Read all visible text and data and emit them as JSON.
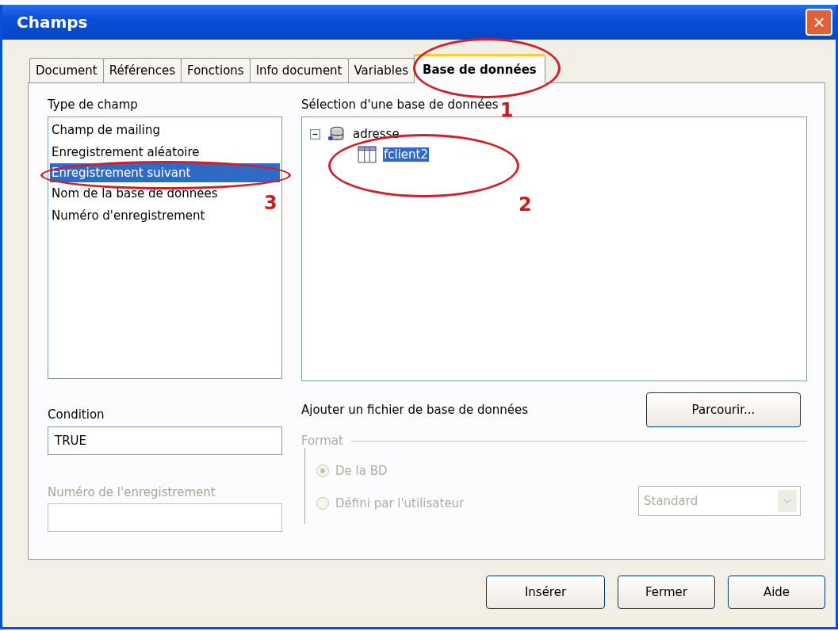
{
  "window": {
    "title": "Champs",
    "close": "×"
  },
  "tabs": [
    {
      "label": "Document",
      "selected": false
    },
    {
      "label": "Références",
      "selected": false
    },
    {
      "label": "Fonctions",
      "selected": false
    },
    {
      "label": "Info document",
      "selected": false
    },
    {
      "label": "Variables",
      "selected": false
    },
    {
      "label": "Base de données",
      "selected": true
    }
  ],
  "field_type": {
    "label": "Type de champ",
    "items": [
      {
        "label": "Champ de mailing",
        "selected": false
      },
      {
        "label": "Enregistrement aléatoire",
        "selected": false
      },
      {
        "label": "Enregistrement suivant",
        "selected": true
      },
      {
        "label": "Nom de la base de données",
        "selected": false
      },
      {
        "label": "Numéro d'enregistrement",
        "selected": false
      }
    ]
  },
  "database": {
    "label": "Sélection d'une base de données",
    "tree": [
      {
        "label": "adresse",
        "expanded": true,
        "selected": false,
        "children": [
          {
            "label": "fclient2",
            "selected": true
          }
        ]
      }
    ]
  },
  "add_file": {
    "label": "Ajouter un fichier de base de données",
    "button": "Parcourir..."
  },
  "condition": {
    "label": "Condition",
    "value": "TRUE"
  },
  "record_number": {
    "label": "Numéro de l'enregistrement",
    "disabled": true
  },
  "format": {
    "legend": "Format",
    "disabled": true,
    "options": [
      {
        "label": "De la BD",
        "selected": true
      },
      {
        "label": "Défini par l'utilisateur",
        "selected": false
      }
    ],
    "select": "Standard"
  },
  "buttons": [
    "Insérer",
    "Fermer",
    "Aide"
  ],
  "annotations": [
    "1",
    "2",
    "3"
  ]
}
